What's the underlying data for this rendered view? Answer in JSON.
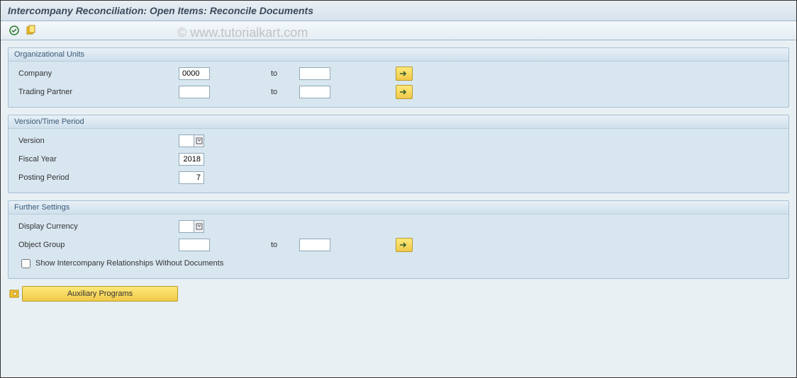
{
  "title": "Intercompany Reconciliation: Open Items: Reconcile Documents",
  "watermark": "© www.tutorialkart.com",
  "groups": {
    "org": {
      "title": "Organizational Units",
      "company_label": "Company",
      "company_value": "0000",
      "company_to": "to",
      "partner_label": "Trading Partner",
      "partner_to": "to"
    },
    "version": {
      "title": "Version/Time Period",
      "version_label": "Version",
      "fiscal_label": "Fiscal Year",
      "fiscal_value": "2018",
      "period_label": "Posting Period",
      "period_value": "7"
    },
    "further": {
      "title": "Further Settings",
      "currency_label": "Display Currency",
      "objgroup_label": "Object Group",
      "objgroup_to": "to",
      "show_rel_label": "Show Intercompany Relationships Without Documents"
    }
  },
  "aux_button": "Auxiliary Programs"
}
